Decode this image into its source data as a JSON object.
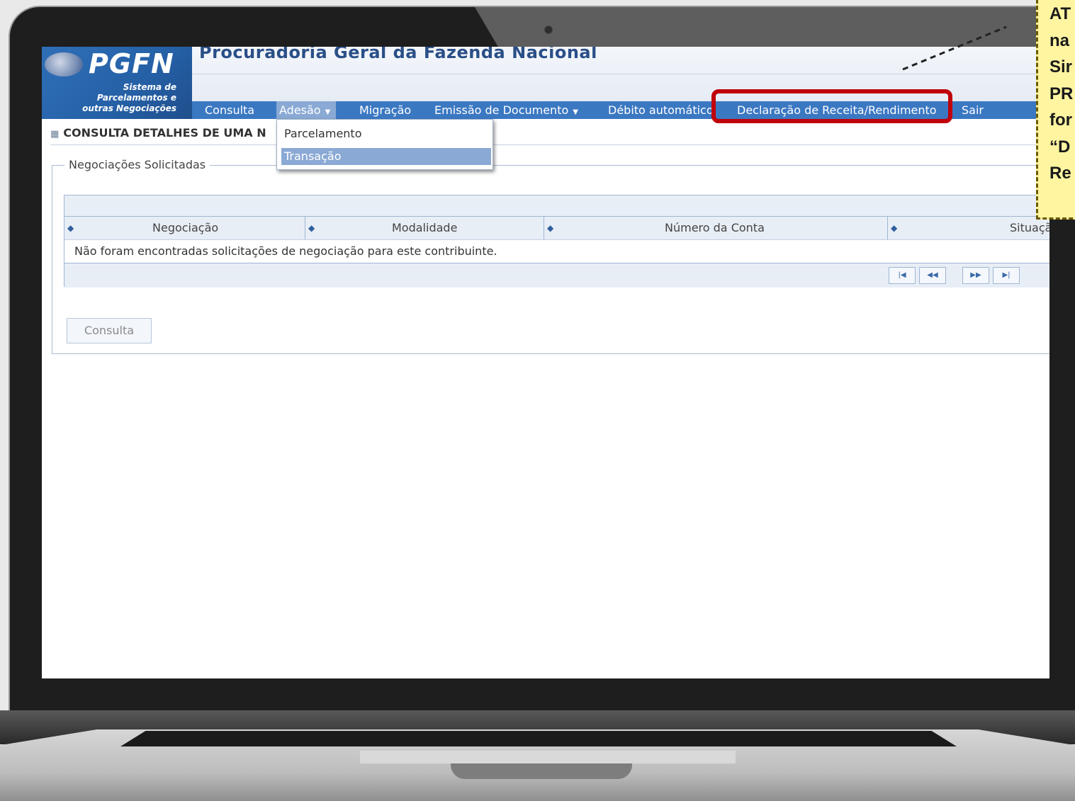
{
  "header": {
    "logo_title": "PGFN",
    "logo_subtitle_lines": [
      "Sistema de",
      "Parcelamentos e",
      "outras Negociações"
    ],
    "app_title": "Procuradoria Geral da Fazenda Nacional"
  },
  "nav": {
    "items": [
      {
        "label": "Consulta"
      },
      {
        "label": "Adesão",
        "dropdown": true,
        "active": true
      },
      {
        "label": "Migração"
      },
      {
        "label": "Emissão de Documento",
        "dropdown": true
      },
      {
        "label": "Débito automático"
      },
      {
        "label": "Declaração de Receita/Rendimento",
        "highlighted": true
      },
      {
        "label": "Sair"
      }
    ]
  },
  "dropdown": {
    "items": [
      {
        "label": "Parcelamento"
      },
      {
        "label": "Transação",
        "selected": true
      }
    ]
  },
  "page": {
    "heading": "CONSULTA DETALHES DE UMA N"
  },
  "fieldset": {
    "legend": "Negociações Solicitadas"
  },
  "grid": {
    "columns": [
      "Negociação",
      "Modalidade",
      "Número da Conta",
      "Situaçã"
    ],
    "empty_message": "Não foram encontradas solicitações de negociação para este contribuinte.",
    "pager": [
      "first",
      "prev",
      "next",
      "last"
    ]
  },
  "buttons": {
    "consulta": "Consulta"
  },
  "callout": {
    "lines": [
      "AT",
      "na",
      "Sir",
      "PR",
      "for",
      "“D",
      "Re"
    ]
  },
  "colors": {
    "highlight": "#c0000a",
    "nav_bg": "#3b78c2",
    "callout_bg": "#fff5a1"
  }
}
